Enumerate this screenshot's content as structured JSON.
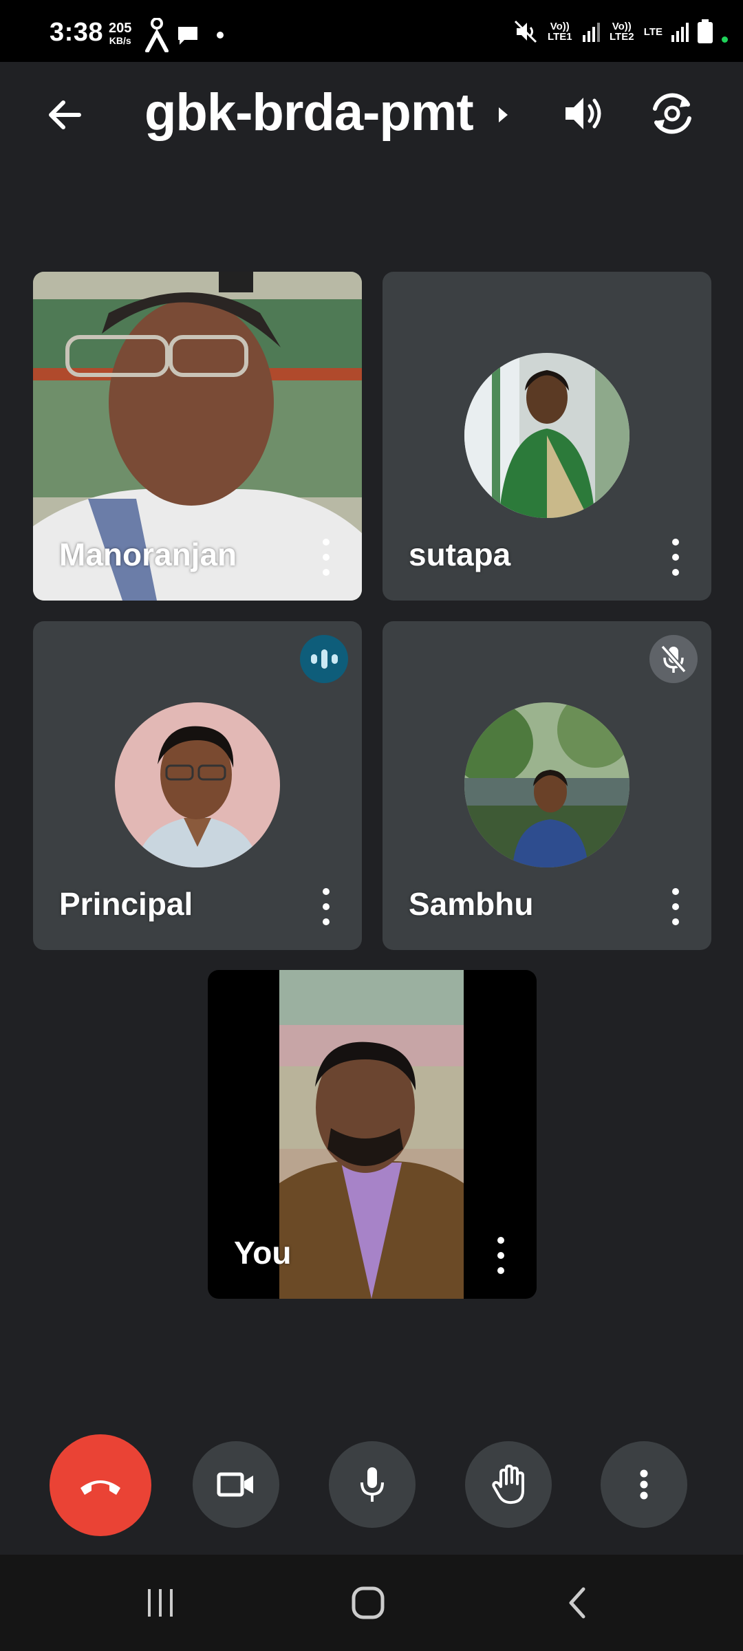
{
  "status_bar": {
    "time": "3:38",
    "net_speed_value": "205",
    "net_speed_unit": "KB/s",
    "sim1_label": "Vo)) LTE1",
    "sim2_label": "Vo)) LTE2",
    "data_label": "LTE"
  },
  "header": {
    "meeting_code": "gbk-brda-pmt"
  },
  "participants": [
    {
      "name": "Manoranjan",
      "video": "on",
      "state": "normal"
    },
    {
      "name": "sutapa",
      "video": "off",
      "state": "normal"
    },
    {
      "name": "Principal",
      "video": "off",
      "state": "speaking"
    },
    {
      "name": "Sambhu",
      "video": "off",
      "state": "muted"
    }
  ],
  "self_view": {
    "name": "You",
    "video": "on"
  },
  "controls": {
    "end_call": "phone-hangup-icon",
    "camera": "video-camera-icon",
    "microphone": "microphone-icon",
    "raise_hand": "hand-icon",
    "more": "more-options-icon"
  },
  "colors": {
    "background": "#202124",
    "tile": "#3c4043",
    "end_call": "#ea4335",
    "speaking": "#0e5d7a"
  }
}
